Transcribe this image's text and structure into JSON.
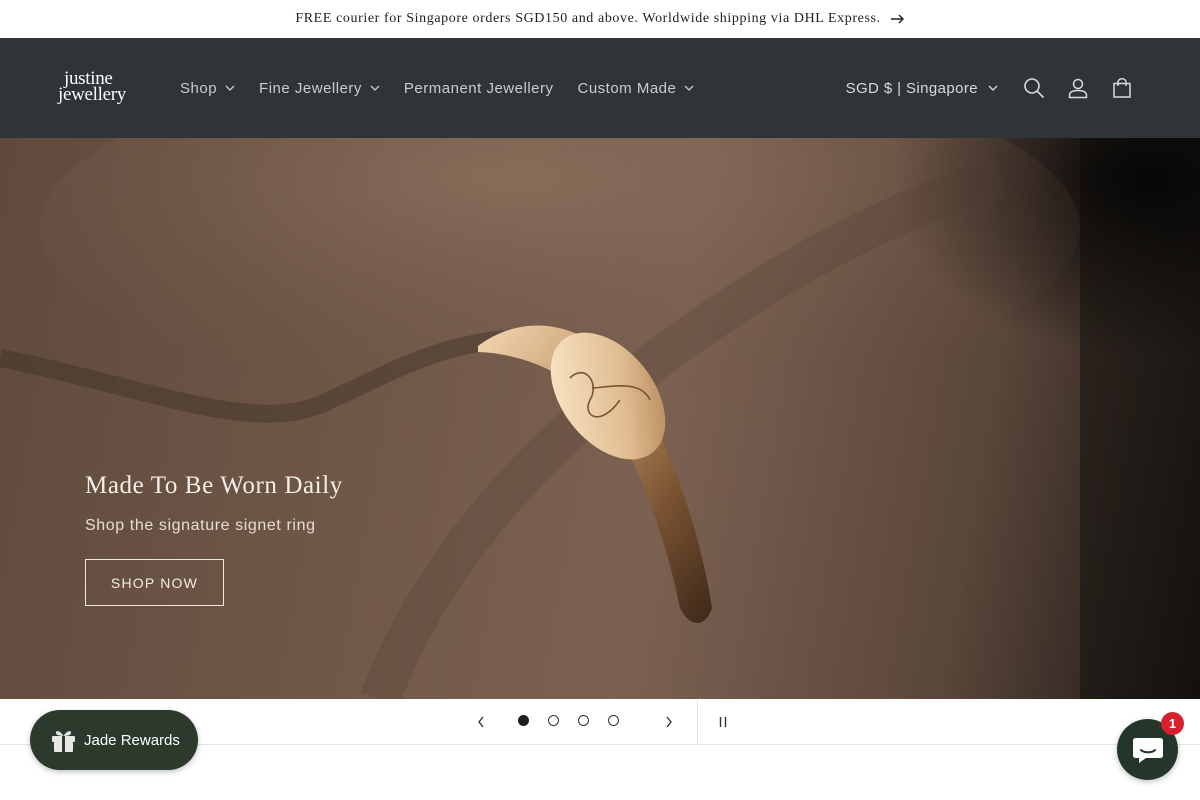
{
  "announcement": {
    "text": "FREE courier for Singapore orders SGD150 and above. Worldwide shipping via DHL Express.",
    "icon": "arrow-right-icon"
  },
  "header": {
    "logo_line1": "justine",
    "logo_line2": "jewellery",
    "nav": [
      {
        "label": "Shop",
        "has_dropdown": true
      },
      {
        "label": "Fine Jewellery",
        "has_dropdown": true
      },
      {
        "label": "Permanent Jewellery",
        "has_dropdown": false
      },
      {
        "label": "Custom Made",
        "has_dropdown": true
      }
    ],
    "currency": "SGD $ | Singapore",
    "icons": [
      "search-icon",
      "account-icon",
      "cart-icon"
    ],
    "background": "#2f3437"
  },
  "hero": {
    "title": "Made To Be Worn Daily",
    "subtitle": "Shop the signature signet ring",
    "button": "SHOP NOW"
  },
  "slideshow": {
    "slide_count": 4,
    "active_slide": 1
  },
  "rewards": {
    "label": "Jade Rewards",
    "color": "#2b3a2c"
  },
  "chat": {
    "badge": "1",
    "color": "#24352a"
  }
}
